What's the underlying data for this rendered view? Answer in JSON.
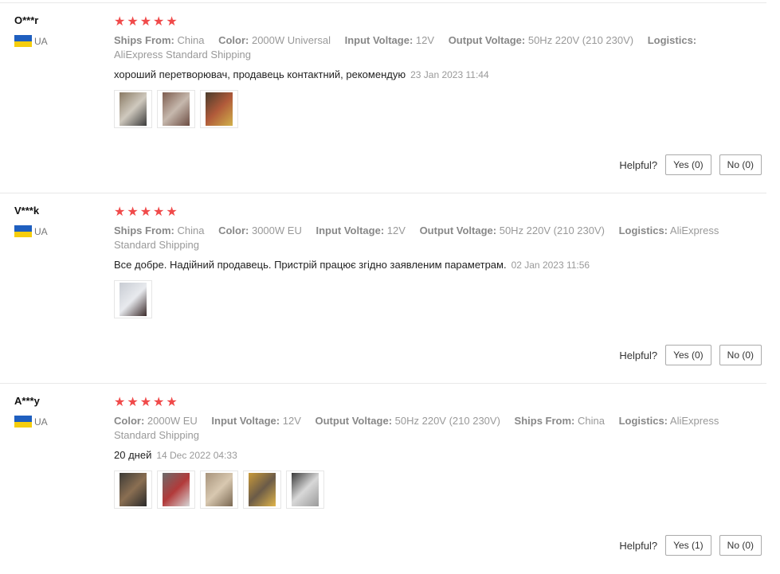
{
  "helpful_label": "Helpful?",
  "star_color": "#f04a4a",
  "reviews": [
    {
      "user": "O***r",
      "country": "UA",
      "rating": 5,
      "attributes": [
        {
          "label": "Ships From:",
          "value": "China"
        },
        {
          "label": "Color:",
          "value": "2000W Universal"
        },
        {
          "label": "Input Voltage:",
          "value": "12V"
        },
        {
          "label": "Output Voltage:",
          "value": "50Hz 220V (210 230V)"
        },
        {
          "label": "Logistics:",
          "value": "AliExpress Standard Shipping"
        }
      ],
      "comment": "хороший перетворювач, продавець контактний, рекомендую",
      "date": "23 Jan 2023 11:44",
      "photos": [
        {
          "colors": [
            "#8a7a64",
            "#cfc9be",
            "#3b3b3b"
          ]
        },
        {
          "colors": [
            "#7e5d4f",
            "#c6b8ad",
            "#6c4c42"
          ]
        },
        {
          "colors": [
            "#4a3c2c",
            "#b05a3a",
            "#d1b14a"
          ]
        }
      ],
      "yes": "Yes (0)",
      "no": "No (0)"
    },
    {
      "user": "V***k",
      "country": "UA",
      "rating": 5,
      "attributes": [
        {
          "label": "Ships From:",
          "value": "China"
        },
        {
          "label": "Color:",
          "value": "3000W EU"
        },
        {
          "label": "Input Voltage:",
          "value": "12V"
        },
        {
          "label": "Output Voltage:",
          "value": "50Hz 220V (210 230V)"
        },
        {
          "label": "Logistics:",
          "value": "AliExpress Standard Shipping"
        }
      ],
      "comment": "Все добре. Надійний продавець. Пристрій працює згідно заявленим параметрам.",
      "date": "02 Jan 2023 11:56",
      "photos": [
        {
          "colors": [
            "#c8ccd3",
            "#e8eaee",
            "#3a2a2a"
          ]
        }
      ],
      "yes": "Yes (0)",
      "no": "No (0)"
    },
    {
      "user": "A***y",
      "country": "UA",
      "rating": 5,
      "attributes": [
        {
          "label": "Color:",
          "value": "2000W EU"
        },
        {
          "label": "Input Voltage:",
          "value": "12V"
        },
        {
          "label": "Output Voltage:",
          "value": "50Hz 220V (210 230V)"
        },
        {
          "label": "Ships From:",
          "value": "China"
        },
        {
          "label": "Logistics:",
          "value": "AliExpress Standard Shipping"
        }
      ],
      "comment": "20 дней",
      "date": "14 Dec 2022 04:33",
      "photos": [
        {
          "colors": [
            "#3c3a36",
            "#8a6f52",
            "#2a2a2a"
          ]
        },
        {
          "colors": [
            "#6c6c6c",
            "#b23a3a",
            "#d7d7d7"
          ]
        },
        {
          "colors": [
            "#a8947c",
            "#d8c8b0",
            "#7a6852"
          ]
        },
        {
          "colors": [
            "#c99a3a",
            "#6b5b48",
            "#e0b54a"
          ]
        },
        {
          "colors": [
            "#3a3a3a",
            "#d8d8d8",
            "#9a9a9a"
          ]
        }
      ],
      "yes": "Yes (1)",
      "no": "No (0)"
    }
  ]
}
